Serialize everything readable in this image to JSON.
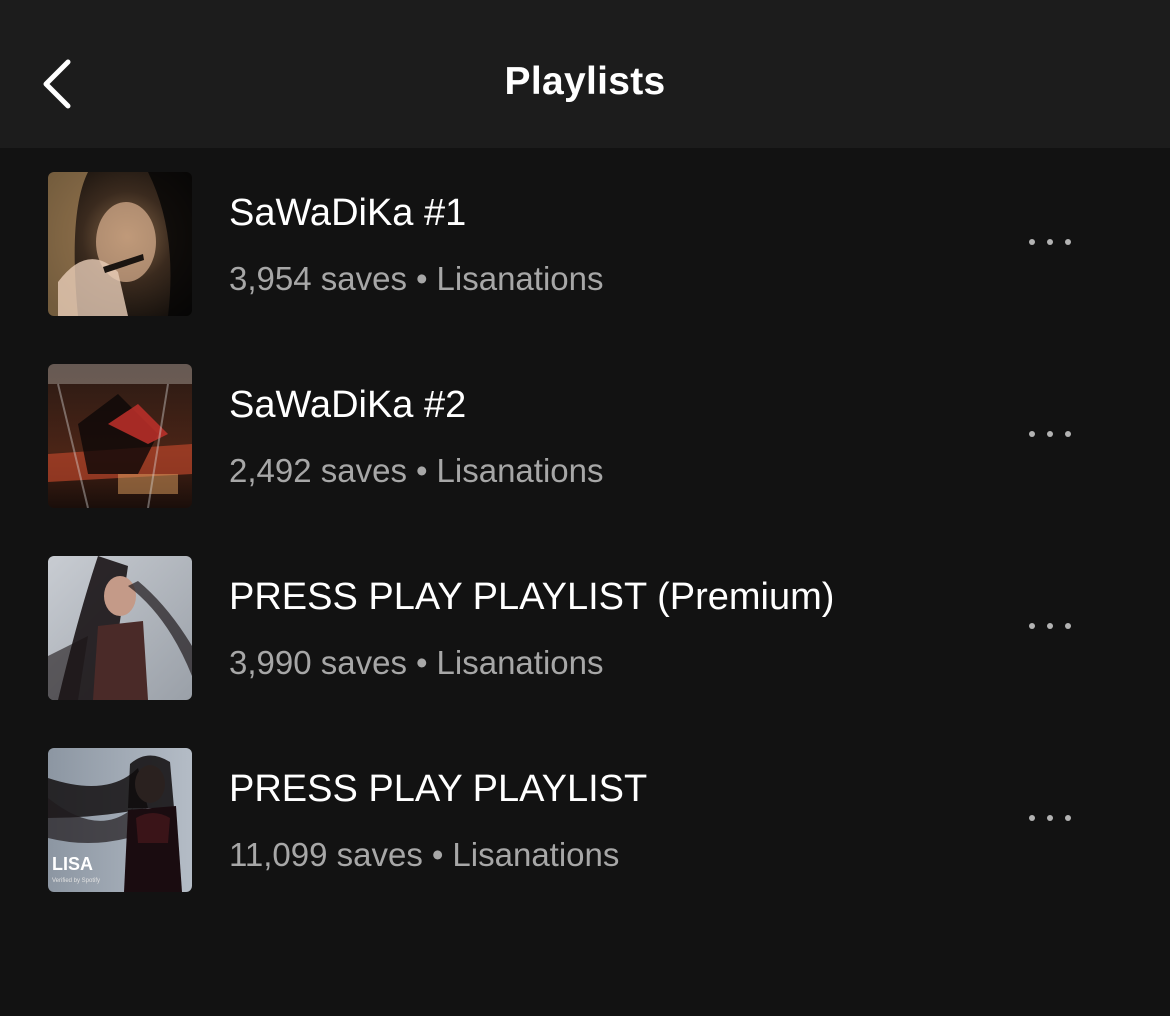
{
  "header": {
    "title": "Playlists",
    "back_icon": "chevron-left-icon"
  },
  "playlists": [
    {
      "name": "SaWaDiKa #1",
      "saves": "3,954 saves",
      "owner": "Lisanations",
      "separator": "•",
      "more_icon": "more-horizontal-icon"
    },
    {
      "name": "SaWaDiKa #2",
      "saves": "2,492 saves",
      "owner": "Lisanations",
      "separator": "•",
      "more_icon": "more-horizontal-icon"
    },
    {
      "name": "PRESS PLAY PLAYLIST (Premium)",
      "saves": "3,990 saves",
      "owner": "Lisanations",
      "separator": "•",
      "more_icon": "more-horizontal-icon"
    },
    {
      "name": "PRESS PLAY PLAYLIST",
      "saves": "11,099 saves",
      "owner": "Lisanations",
      "separator": "•",
      "more_icon": "more-horizontal-icon",
      "cover_label": "LISA",
      "cover_sub": "Verified by Spotify"
    }
  ],
  "colors": {
    "background": "#121212",
    "header_background": "#1c1c1c",
    "primary_text": "#ffffff",
    "secondary_text": "#a7a7a7"
  }
}
